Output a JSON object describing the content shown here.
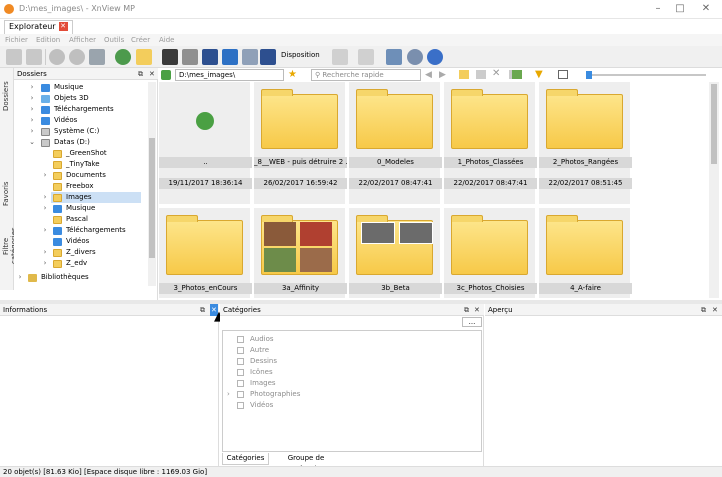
{
  "window": {
    "title": "D:\\mes_images\\ - XnView MP"
  },
  "tab": {
    "label": "Explorateur"
  },
  "menu": [
    "Fichier",
    "Edition",
    "Afficher",
    "Outils",
    "Créer",
    "Aide"
  ],
  "toolbar": {
    "disposition_label": "Disposition"
  },
  "left_tabs": [
    "Dossiers",
    "Favoris",
    "Filtre catégories"
  ],
  "folders_panel": {
    "title": "Dossiers",
    "items": [
      {
        "label": "Musique",
        "icon": "music-folder-icon"
      },
      {
        "label": "Objets 3D",
        "icon": "3d-folder-icon"
      },
      {
        "label": "Téléchargements",
        "icon": "download-folder-icon"
      },
      {
        "label": "Vidéos",
        "icon": "video-folder-icon"
      },
      {
        "label": "Système (C:)",
        "icon": "drive-icon"
      },
      {
        "label": "Datas (D:)",
        "icon": "drive-icon"
      },
      {
        "label": "_GreenShot",
        "icon": "folder-icon"
      },
      {
        "label": "_TinyTake",
        "icon": "folder-icon"
      },
      {
        "label": "Documents",
        "icon": "folder-icon"
      },
      {
        "label": "Freebox",
        "icon": "folder-icon"
      },
      {
        "label": "Images",
        "icon": "folder-icon"
      },
      {
        "label": "Musique",
        "icon": "music-folder-icon"
      },
      {
        "label": "Pascal",
        "icon": "folder-icon"
      },
      {
        "label": "Téléchargements",
        "icon": "download-folder-icon"
      },
      {
        "label": "Vidéos",
        "icon": "video-folder-icon"
      },
      {
        "label": "Z_divers",
        "icon": "folder-icon"
      },
      {
        "label": "Z_edv",
        "icon": "folder-icon"
      },
      {
        "label": "Bibliothèques",
        "icon": "library-icon"
      }
    ]
  },
  "address": {
    "path": "D:\\mes_images\\",
    "search_placeholder": "Recherche rapide"
  },
  "thumbnails": [
    {
      "name": "..",
      "date": "19/11/2017 18:36:14",
      "kind": "up"
    },
    {
      "name": "_8__WEB - puis détruire 2 ...",
      "date": "26/02/2017 16:59:42",
      "kind": "folder"
    },
    {
      "name": "0_Modeles",
      "date": "22/02/2017 08:47:41",
      "kind": "folder"
    },
    {
      "name": "1_Photos_Classées",
      "date": "22/02/2017 08:47:41",
      "kind": "folder"
    },
    {
      "name": "2_Photos_Rangées",
      "date": "22/02/2017 08:51:45",
      "kind": "folder"
    },
    {
      "name": "3_Photos_enCours",
      "date": "",
      "kind": "folder"
    },
    {
      "name": "3a_Affinity",
      "date": "",
      "kind": "photos"
    },
    {
      "name": "3b_Beta",
      "date": "",
      "kind": "grey"
    },
    {
      "name": "3c_Photos_Choisies",
      "date": "",
      "kind": "folder"
    },
    {
      "name": "4_A-faire",
      "date": "",
      "kind": "folder"
    }
  ],
  "info_panel": {
    "title": "Informations"
  },
  "categories_panel": {
    "title": "Catégories",
    "items": [
      "Audios",
      "Autre",
      "Dessins",
      "Icônes",
      "Images",
      "Photographies",
      "Vidéos"
    ],
    "tabs": [
      "Catégories",
      "Groupe de catégories"
    ],
    "combo_value": "..."
  },
  "preview_panel": {
    "title": "Aperçu"
  },
  "status": {
    "text": "20 objet(s) [81.63 Kio] [Espace disque libre : 1169.03 Gio]"
  },
  "colors": {
    "accent": "#3a8be0",
    "folder": "#f7c948",
    "close_tab": "#e24c38"
  }
}
